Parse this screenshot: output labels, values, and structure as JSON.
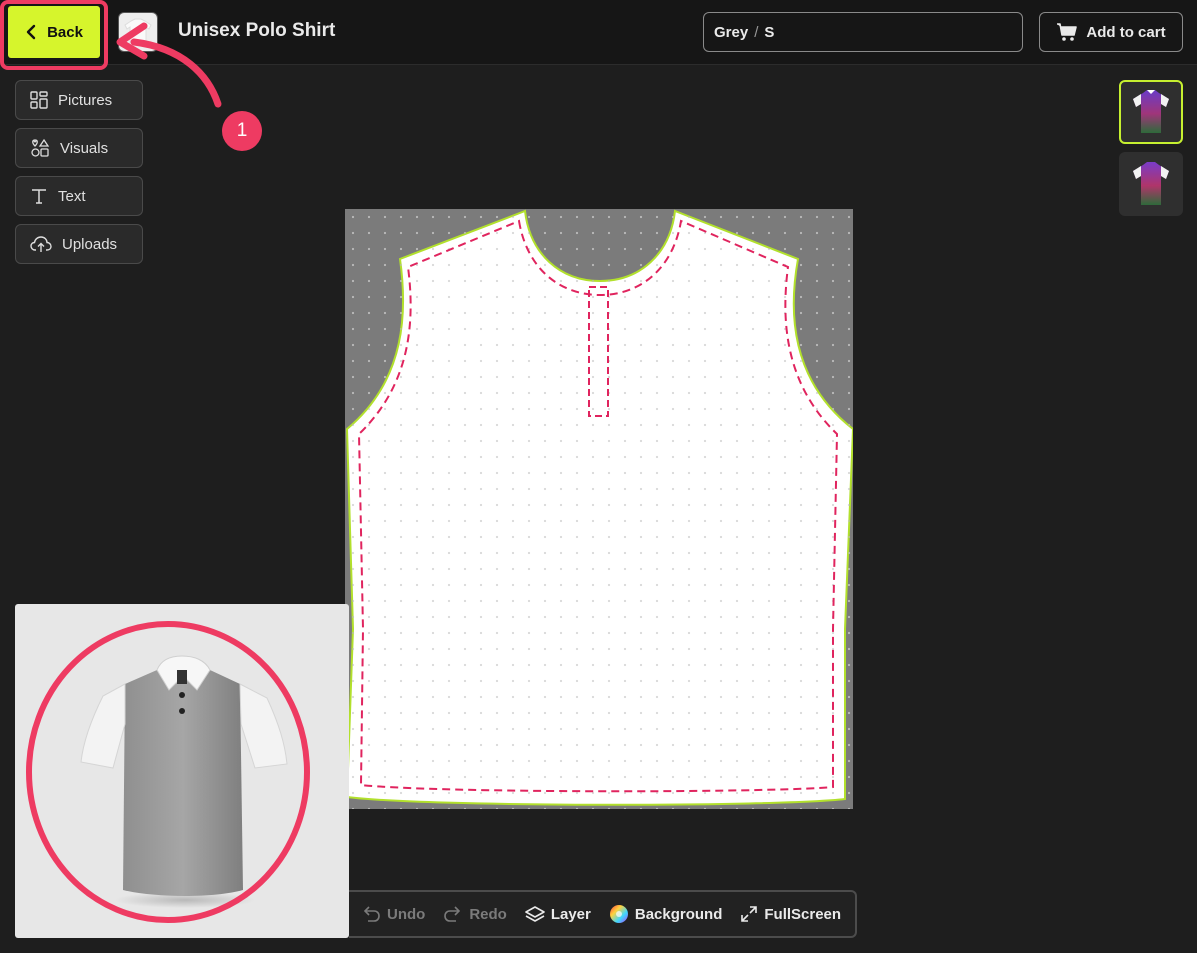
{
  "header": {
    "back_label": "Back",
    "title": "Unisex Polo Shirt",
    "variant": {
      "color": "Grey",
      "separator": "/",
      "size": "S"
    },
    "cart_label": "Add to cart"
  },
  "sidebar": {
    "items": [
      {
        "label": "Pictures",
        "icon": "grid-icon"
      },
      {
        "label": "Visuals",
        "icon": "shapes-icon"
      },
      {
        "label": "Text",
        "icon": "text-icon"
      },
      {
        "label": "Uploads",
        "icon": "cloud-upload-icon"
      }
    ]
  },
  "views": [
    {
      "name": "front-view",
      "active": true
    },
    {
      "name": "back-view",
      "active": false
    }
  ],
  "toolbar": {
    "undo": "Undo",
    "redo": "Redo",
    "layer": "Layer",
    "background": "Background",
    "fullscreen": "FullScreen"
  },
  "annotation": {
    "step": "1"
  },
  "colors": {
    "accent": "#d6f52c",
    "highlight": "#ee3b62",
    "cut_line": "#c6f030",
    "safe_line": "#e0245e",
    "canvas_bg": "#7b7b7b"
  }
}
